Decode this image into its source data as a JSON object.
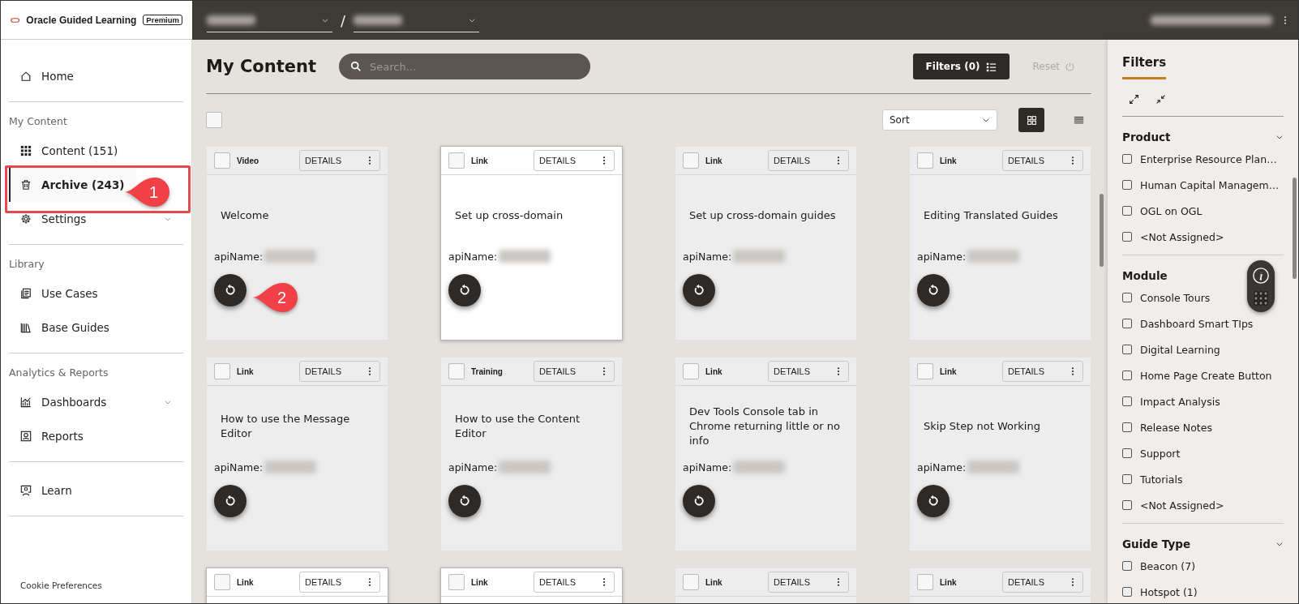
{
  "brand": {
    "name": "Oracle Guided Learning",
    "tier": "Premium"
  },
  "top_bar": {
    "separator": "/"
  },
  "sidebar": {
    "sections": [
      {
        "items": [
          {
            "label": "Home",
            "selected": false,
            "expandable": false
          }
        ]
      },
      {
        "heading": "My Content",
        "items": [
          {
            "label": "Content (151)",
            "selected": false,
            "expandable": false
          },
          {
            "label": "Archive (243)",
            "selected": true,
            "expandable": false
          },
          {
            "label": "Settings",
            "selected": false,
            "expandable": true
          }
        ]
      },
      {
        "heading": "Library",
        "items": [
          {
            "label": "Use Cases",
            "selected": false,
            "expandable": false
          },
          {
            "label": "Base Guides",
            "selected": false,
            "expandable": false
          }
        ]
      },
      {
        "heading": "Analytics & Reports",
        "items": [
          {
            "label": "Dashboards",
            "selected": false,
            "expandable": true
          },
          {
            "label": "Reports",
            "selected": false,
            "expandable": false
          }
        ]
      },
      {
        "items": [
          {
            "label": "Learn",
            "selected": false,
            "expandable": false
          }
        ]
      }
    ],
    "footer_link": "Cookie Preferences"
  },
  "main": {
    "title": "My Content",
    "search": {
      "placeholder": "Search..."
    },
    "filters_button": "Filters (0)",
    "reset": {
      "label": "Reset",
      "disabled": true
    },
    "sort": {
      "value": "Sort"
    },
    "view_toggles": [
      {
        "selected": true
      },
      {
        "selected": false
      }
    ],
    "select_all": {
      "checked": false
    },
    "cards": [
      {
        "type": "Video",
        "details": "DETAILS",
        "title": "Welcome",
        "api_label": "apiName:",
        "highlighted": false,
        "checked": false
      },
      {
        "type": "Link",
        "details": "DETAILS",
        "title": "Set up cross-domain",
        "api_label": "apiName:",
        "highlighted": true,
        "checked": false
      },
      {
        "type": "Link",
        "details": "DETAILS",
        "title": "Set up cross-domain guides",
        "api_label": "apiName:",
        "highlighted": false,
        "checked": false
      },
      {
        "type": "Link",
        "details": "DETAILS",
        "title": "Editing Translated Guides",
        "api_label": "apiName:",
        "highlighted": false,
        "checked": false
      },
      {
        "type": "Link",
        "details": "DETAILS",
        "title": "How to use the Message Editor",
        "api_label": "apiName:",
        "highlighted": false,
        "checked": false
      },
      {
        "type": "Training",
        "details": "DETAILS",
        "title": "How to use the Content Editor",
        "api_label": "apiName:",
        "highlighted": false,
        "checked": false
      },
      {
        "type": "Link",
        "details": "DETAILS",
        "title": "Dev Tools Console tab in Chrome returning little or no info",
        "api_label": "apiName:",
        "highlighted": false,
        "checked": false
      },
      {
        "type": "Link",
        "details": "DETAILS",
        "title": "Skip Step not Working",
        "api_label": "apiName:",
        "highlighted": false,
        "checked": false
      },
      {
        "type": "Link",
        "details": "DETAILS",
        "highlighted": true,
        "checked": false
      },
      {
        "type": "Link",
        "details": "DETAILS",
        "highlighted": true,
        "checked": false
      },
      {
        "type": "Link",
        "details": "DETAILS",
        "highlighted": false,
        "checked": false
      },
      {
        "type": "Link",
        "details": "DETAILS",
        "highlighted": false,
        "checked": false
      }
    ]
  },
  "filter_panel": {
    "title": "Filters",
    "groups": [
      {
        "title": "Product",
        "collapsible": true,
        "options": [
          {
            "label": "Enterprise Resource Plan…",
            "checked": false
          },
          {
            "label": "Human Capital Managem…",
            "checked": false
          },
          {
            "label": "OGL on OGL",
            "checked": false
          },
          {
            "label": "<Not Assigned>",
            "checked": false
          }
        ]
      },
      {
        "title": "Module",
        "collapsible": false,
        "options": [
          {
            "label": "Console Tours",
            "checked": false
          },
          {
            "label": "Dashboard Smart TIps",
            "checked": false
          },
          {
            "label": "Digital Learning",
            "checked": false
          },
          {
            "label": "Home Page Create Button",
            "checked": false
          },
          {
            "label": "Impact Analysis",
            "checked": false
          },
          {
            "label": "Release Notes",
            "checked": false
          },
          {
            "label": "Support",
            "checked": false
          },
          {
            "label": "Tutorials",
            "checked": false
          },
          {
            "label": "<Not Assigned>",
            "checked": false
          }
        ]
      },
      {
        "title": "Guide Type",
        "collapsible": true,
        "options": [
          {
            "label": "Beacon (7)",
            "checked": false
          },
          {
            "label": "Hotspot (1)",
            "checked": false
          }
        ]
      }
    ]
  },
  "annotations": [
    {
      "number": "1"
    },
    {
      "number": "2"
    }
  ]
}
